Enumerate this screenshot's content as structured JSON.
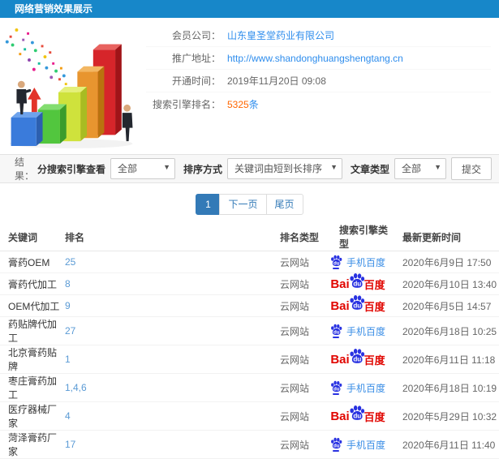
{
  "header": {
    "title": "网络营销效果展示"
  },
  "info": {
    "company": {
      "label": "会员公司：",
      "value": "山东皇圣堂药业有限公司"
    },
    "url": {
      "label": "推广地址：",
      "value": "http://www.shandonghuangshengtang.cn"
    },
    "opened": {
      "label": "开通时间：",
      "value": "2019年11月20日 09:08"
    },
    "rank_count": {
      "label": "搜索引擎排名：",
      "value": "5325",
      "suffix": "条"
    }
  },
  "filters": {
    "result_label": "结果：",
    "engine": {
      "label": "分搜索引擎查看",
      "value": "全部"
    },
    "sort": {
      "label": "排序方式",
      "value": "关键词由短到长排序"
    },
    "article": {
      "label": "文章类型",
      "value": "全部"
    },
    "submit_label": "提交"
  },
  "pagination": {
    "current": "1",
    "next_label": "下一页",
    "last_label": "尾页"
  },
  "table": {
    "headers": {
      "keyword": "关键词",
      "rank": "排名",
      "rank_type": "排名类型",
      "engine": "搜索引擎类型",
      "updated": "最新更新时间"
    },
    "rows": [
      {
        "keyword": "膏药OEM",
        "rank": "25",
        "rank_type": "云网站",
        "engine": "mobile",
        "updated": "2020年6月9日 17:50"
      },
      {
        "keyword": "膏药代加工",
        "rank": "8",
        "rank_type": "云网站",
        "engine": "baidu",
        "updated": "2020年6月10日 13:40"
      },
      {
        "keyword": "OEM代加工",
        "rank": "9",
        "rank_type": "云网站",
        "engine": "baidu",
        "updated": "2020年6月5日 14:57"
      },
      {
        "keyword": "药贴牌代加工",
        "rank": "27",
        "rank_type": "云网站",
        "engine": "mobile",
        "updated": "2020年6月18日 10:25"
      },
      {
        "keyword": "北京膏药贴牌",
        "rank": "1",
        "rank_type": "云网站",
        "engine": "baidu",
        "updated": "2020年6月11日 11:18"
      },
      {
        "keyword": "枣庄膏药加工",
        "rank": "1,4,6",
        "rank_type": "云网站",
        "engine": "mobile",
        "updated": "2020年6月18日 10:19"
      },
      {
        "keyword": "医疗器械厂家",
        "rank": "4",
        "rank_type": "云网站",
        "engine": "baidu",
        "updated": "2020年5月29日 10:32"
      },
      {
        "keyword": "菏泽膏药厂家",
        "rank": "17",
        "rank_type": "云网站",
        "engine": "mobile",
        "updated": "2020年6月11日 11:40"
      }
    ]
  },
  "engines": {
    "mobile": {
      "label": "手机百度"
    },
    "baidu": {
      "bai": "Bai",
      "du": "du",
      "cn": "百度"
    }
  },
  "colors": {
    "header_bg": "#1787c9",
    "link": "#2e8ded",
    "highlight": "#ff6600",
    "rank_number": "#5b9bd5",
    "pager_active": "#337ab7",
    "baidu_red": "#e10601",
    "baidu_blue": "#2932e1",
    "mobile_blue": "#3a8ee6"
  },
  "illustration": {
    "bars": [
      {
        "front": "#3a7bdb",
        "top": "#6ea3ec",
        "side": "#2c5fb0"
      },
      {
        "front": "#52c63e",
        "top": "#83dd70",
        "side": "#3b9c2c"
      },
      {
        "front": "#cfe23c",
        "top": "#e4f07a",
        "side": "#a8bc22"
      },
      {
        "front": "#e8952f",
        "top": "#f3b763",
        "side": "#b9720f"
      },
      {
        "front": "#d6252a",
        "top": "#e8625f",
        "side": "#a01418"
      }
    ]
  }
}
